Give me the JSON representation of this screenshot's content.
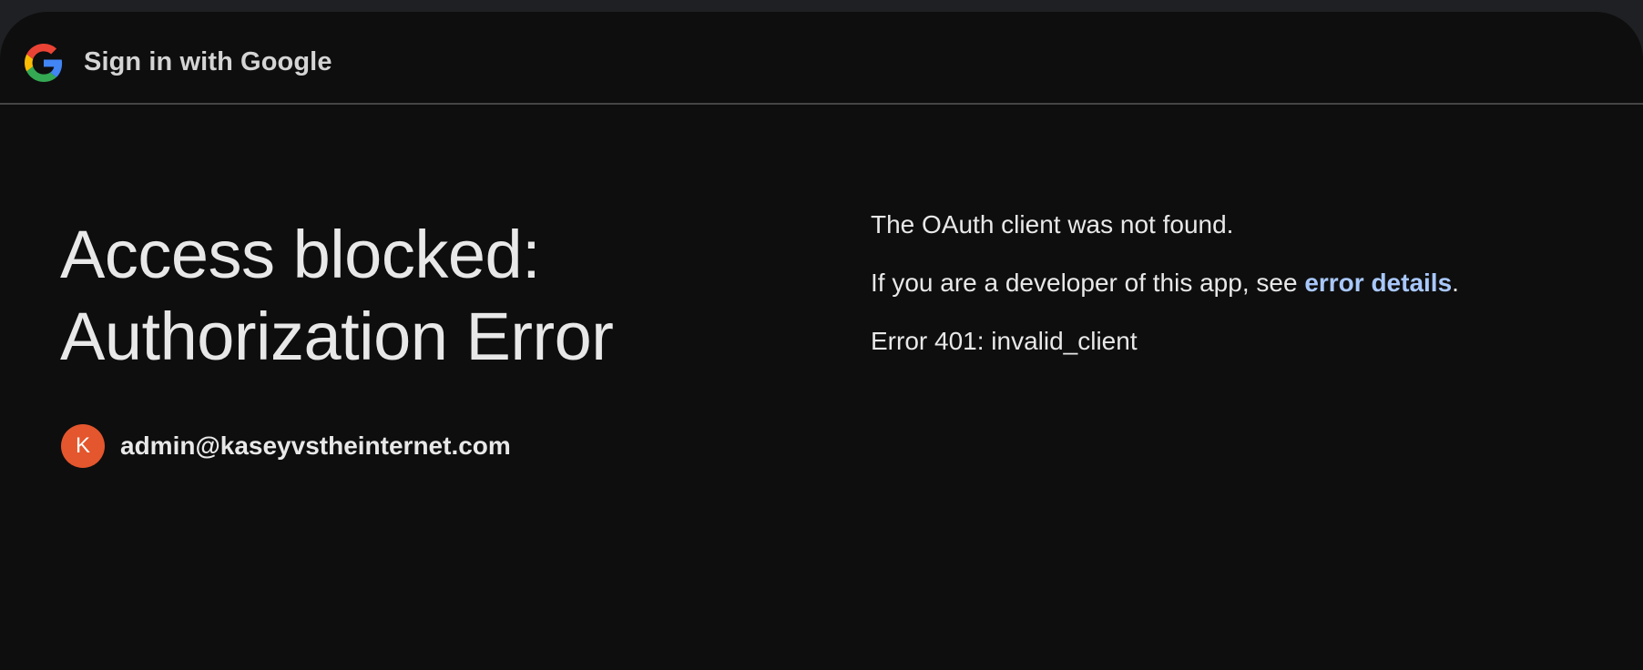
{
  "header": {
    "title": "Sign in with Google",
    "logo_icon": "google-g-logo-icon"
  },
  "main": {
    "heading_line1": "Access blocked:",
    "heading_line2": "Authorization Error",
    "account": {
      "avatar_letter": "K",
      "avatar_color": "#e4562d",
      "email": "admin@kaseyvstheinternet.com"
    }
  },
  "error": {
    "message": "The OAuth client was not found.",
    "developer_prefix": "If you are a developer of this app, see ",
    "details_link": "error details",
    "developer_suffix": ".",
    "code": "Error 401: invalid_client"
  },
  "colors": {
    "background": "#0e0e0e",
    "text": "#e8e8e8",
    "link": "#a8c7fa"
  }
}
